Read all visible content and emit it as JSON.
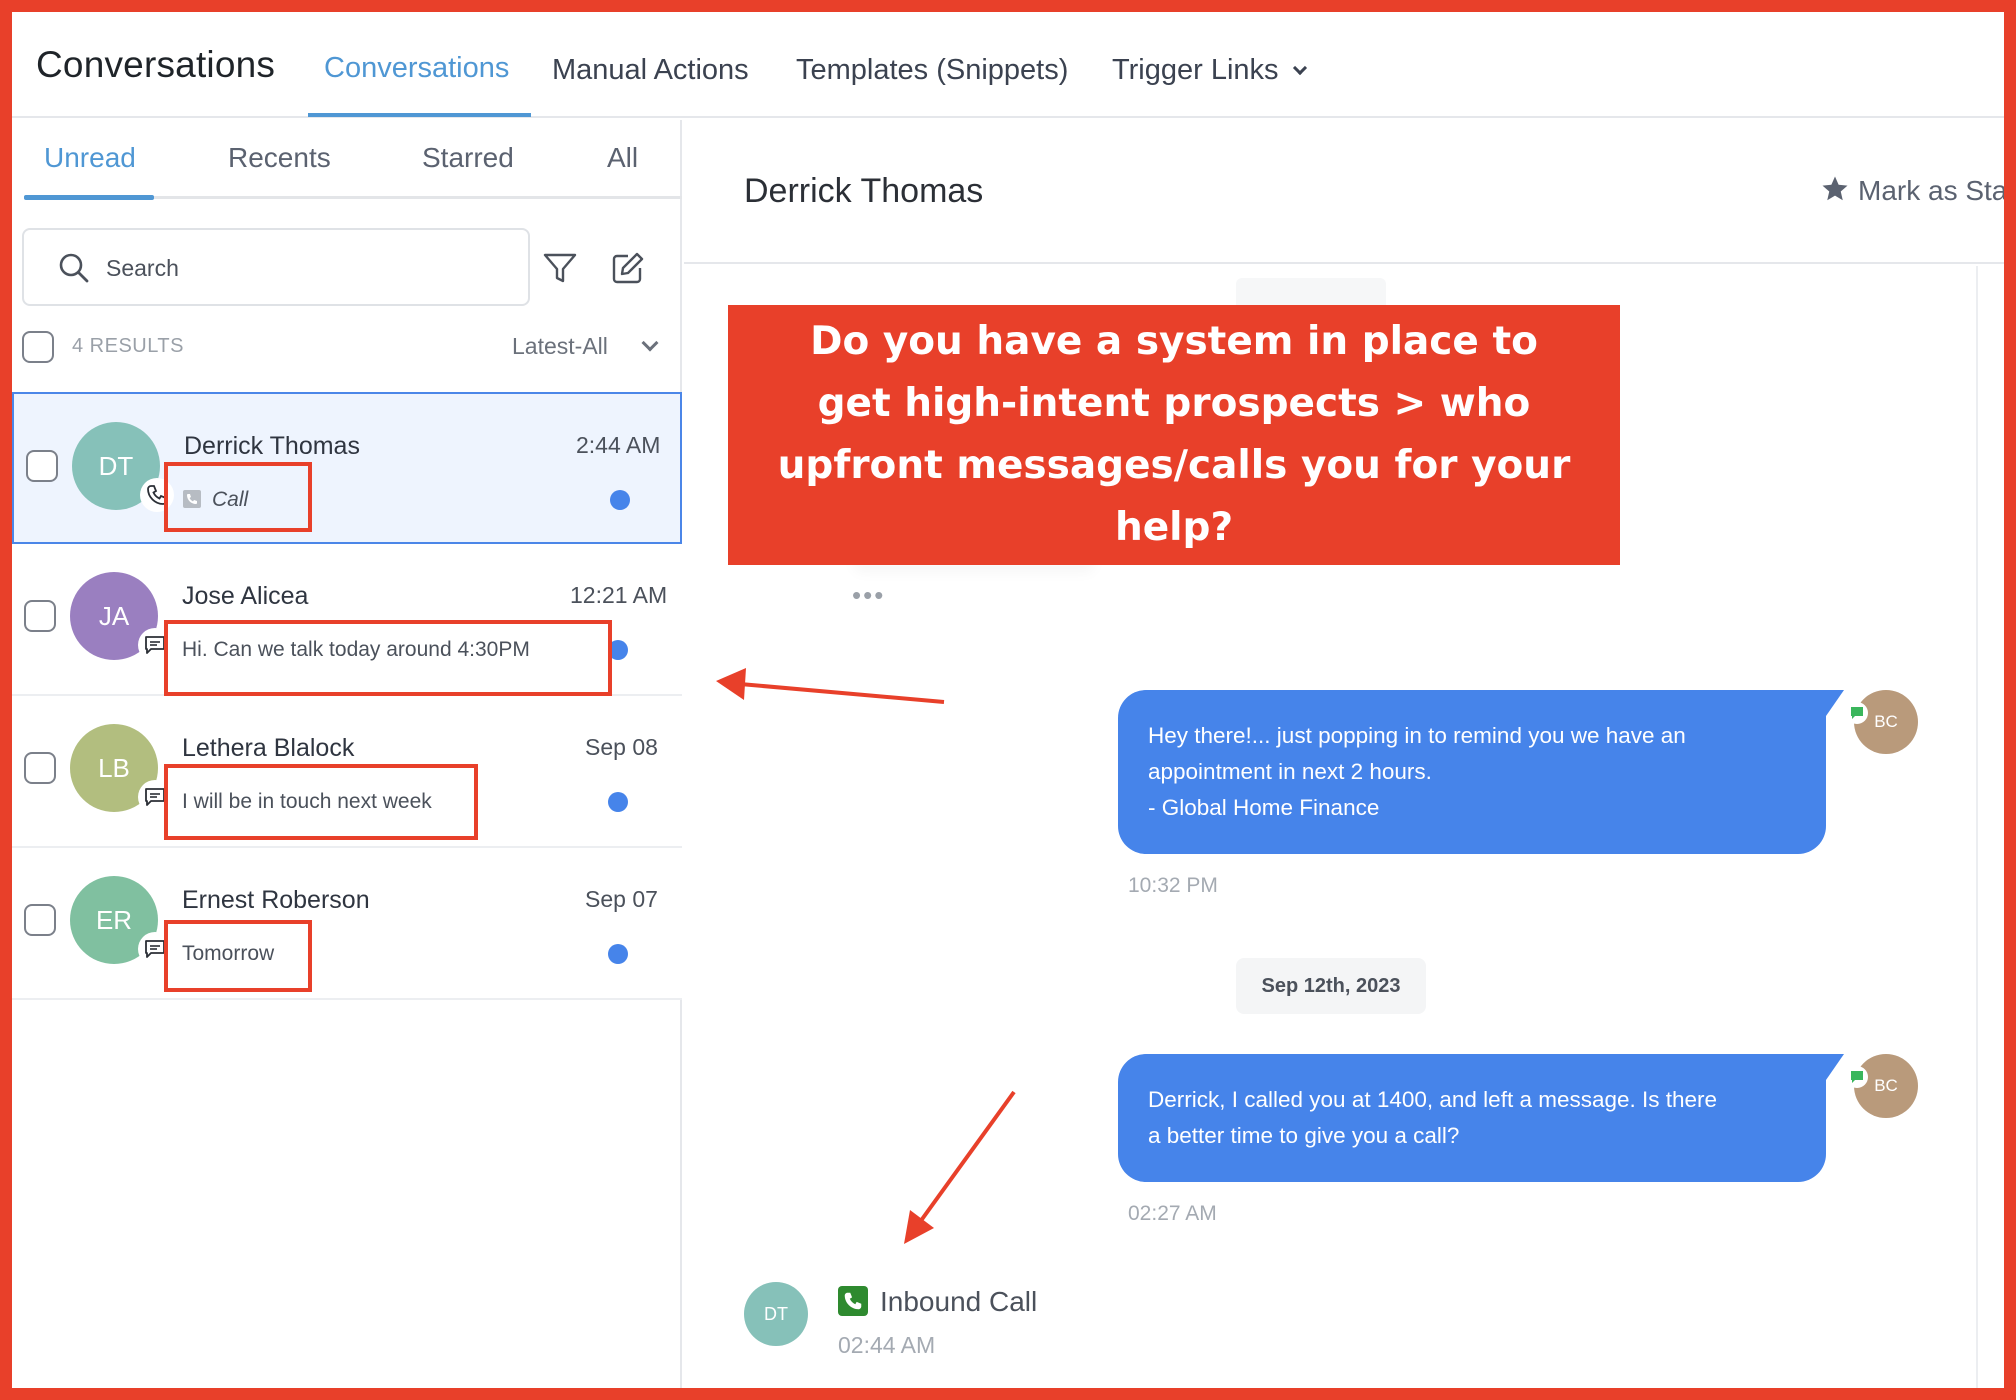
{
  "app": {
    "title": "Conversations"
  },
  "nav": {
    "tabs": [
      {
        "label": "Conversations"
      },
      {
        "label": "Manual Actions"
      },
      {
        "label": "Templates (Snippets)"
      },
      {
        "label": "Trigger Links"
      }
    ],
    "active_index": 0
  },
  "sidebar": {
    "subtabs": [
      {
        "label": "Unread"
      },
      {
        "label": "Recents"
      },
      {
        "label": "Starred"
      },
      {
        "label": "All"
      }
    ],
    "search": {
      "placeholder": "Search",
      "value": ""
    },
    "results": "4 RESULTS",
    "sort": "Latest-All",
    "conversations": [
      {
        "initials": "DT",
        "name": "Derrick Thomas",
        "time": "2:44 AM",
        "preview": "Call",
        "channel": "phone-icon",
        "avatar_color": "#86c1b9",
        "unread": true,
        "selected": true
      },
      {
        "initials": "JA",
        "name": "Jose Alicea",
        "time": "12:21 AM",
        "preview": "Hi. Can we talk today around 4:30PM",
        "channel": "sms-icon",
        "avatar_color": "#9a7fc0",
        "unread": true,
        "selected": false
      },
      {
        "initials": "LB",
        "name": "Lethera Blalock",
        "time": "Sep 08",
        "preview": "I will be in touch next week",
        "channel": "sms-icon",
        "avatar_color": "#b2be7f",
        "unread": true,
        "selected": false
      },
      {
        "initials": "ER",
        "name": "Ernest Roberson",
        "time": "Sep 07",
        "preview": "Tomorrow",
        "channel": "sms-icon",
        "avatar_color": "#80c0a0",
        "unread": true,
        "selected": false
      }
    ]
  },
  "chat": {
    "contact_name": "Derrick Thomas",
    "mark_starred": "Mark as Sta",
    "messages": [
      {
        "lines": [
          "Hey there!... just popping in to remind you we have an",
          "appointment in next 2 hours.",
          "- Global Home Finance"
        ],
        "time": "10:32 PM",
        "sender": "BC"
      },
      {
        "lines": [
          "Derrick, I called you at 1400, and left a message. Is there",
          "a better time to give you a call?"
        ],
        "time": "02:27 AM",
        "sender": "BC"
      }
    ],
    "date_divider": "Sep 12th, 2023",
    "inbound": {
      "initials": "DT",
      "label": "Inbound Call",
      "time": "02:44 AM"
    }
  },
  "callout": {
    "lines": [
      "Do you have a system in place to",
      "get high-intent prospects > who",
      "upfront messages/calls you for your",
      "help?"
    ]
  },
  "colors": {
    "accent": "#4f97d4",
    "bubble": "#4684ea",
    "annotation": "#e8402a",
    "unread_dot": "#4684ea"
  }
}
